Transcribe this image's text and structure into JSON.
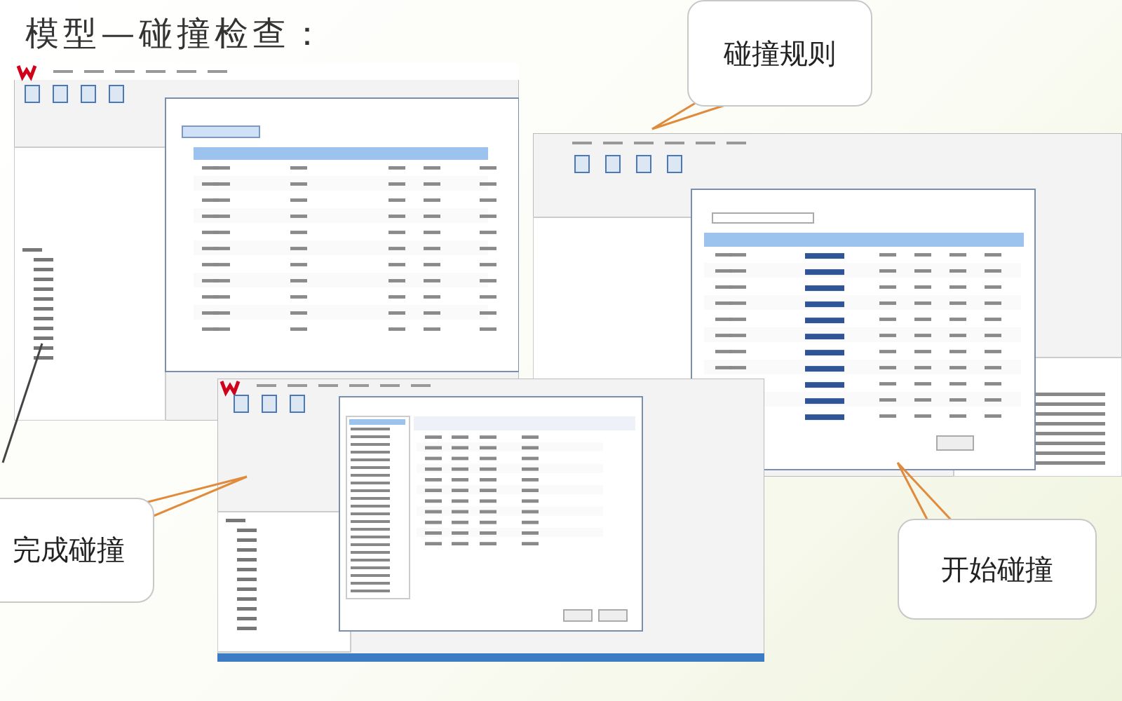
{
  "title": "模型—碰撞检查：",
  "callouts": [
    {
      "text": "碰撞规则"
    },
    {
      "text": "完成碰撞"
    },
    {
      "text": "开始碰撞"
    }
  ]
}
